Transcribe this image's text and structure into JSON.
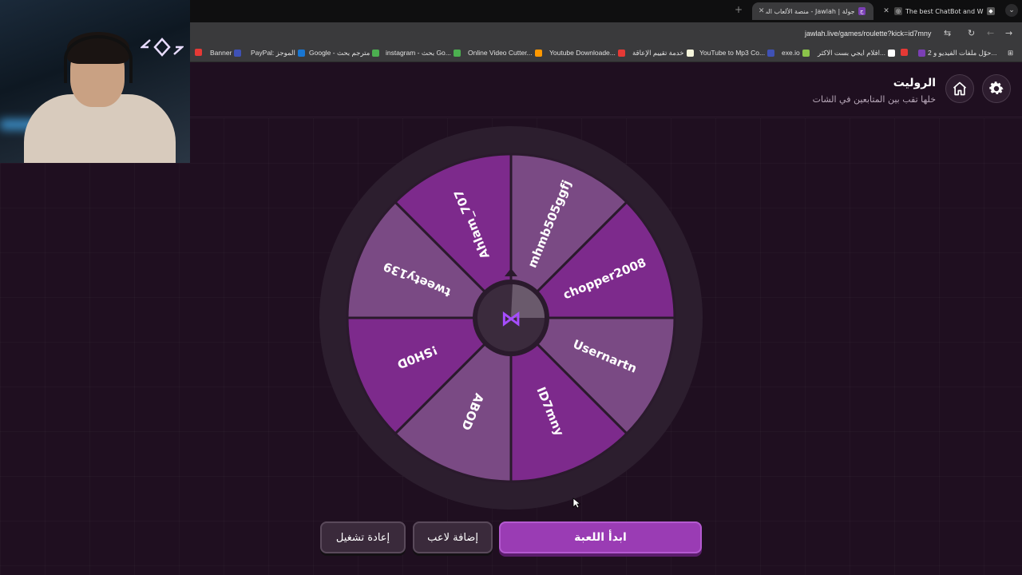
{
  "browser": {
    "tabs": [
      {
        "title": "The best ChatBot and Widg",
        "active": false
      },
      {
        "title": "جولة | Jawlah - منصة الألعاب الت",
        "active": true
      }
    ],
    "url": "jawlah.live/games/roulette?kick=id7mny",
    "bookmarks": [
      {
        "label": "2 حوّل ملفات الفيديو و...",
        "color": "#7b3fb5"
      },
      {
        "label": "",
        "color": "#e53935"
      },
      {
        "label": "افلام ايجي بست الاكثر...",
        "color": "#ffffff"
      },
      {
        "label": "exe.io",
        "color": "#8bc34a"
      },
      {
        "label": "YouTube to Mp3 Co...",
        "color": "#3f51b5"
      },
      {
        "label": "خدمة تقييم الإعاقة",
        "color": "#f5f5dc"
      },
      {
        "label": "Youtube Downloade...",
        "color": "#e53935"
      },
      {
        "label": "Online Video Cutter...",
        "color": "#ff9800"
      },
      {
        "label": "instagram - بحث Go...",
        "color": "#4caf50"
      },
      {
        "label": "Google - مترجم بحث",
        "color": "#4caf50"
      },
      {
        "label": "PayPal: الموجز",
        "color": "#1976d2"
      },
      {
        "label": "Banner",
        "color": "#3f51b5"
      }
    ]
  },
  "header": {
    "title": "الروليت",
    "subtitle": "خلها تقب بين المتابعين في الشات"
  },
  "icons": {
    "settings": "gear-icon",
    "home": "home-icon"
  },
  "wheel": {
    "segments": [
      "mhmb505ggfj",
      "chopper2008",
      "Usernartn",
      "ID7mny",
      "ABOD",
      "!SH0D",
      "tweety139",
      "Ahlam_707"
    ],
    "colors": [
      "#7a4a84",
      "#7d2a8c"
    ],
    "rim_color": "#2c1e2e"
  },
  "buttons": {
    "start": "ابدأ اللعبة",
    "add_player": "إضافة لاعب",
    "restart": "إعادة تشغيل"
  }
}
